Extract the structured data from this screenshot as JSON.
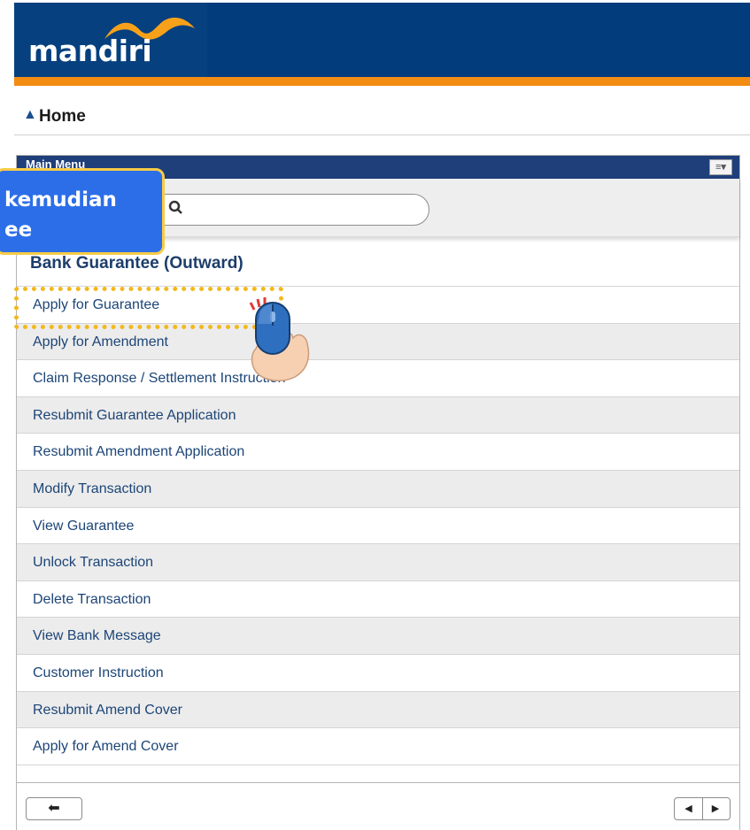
{
  "brand": {
    "name": "mandiri"
  },
  "breadcrumb": {
    "home_label": "Home"
  },
  "panel": {
    "title": "Main Menu",
    "search_placeholder": "",
    "section_title": "Bank Guarantee (Outward)",
    "items": [
      {
        "label": "Apply for Guarantee"
      },
      {
        "label": "Apply for Amendment"
      },
      {
        "label": "Claim Response / Settlement Instruction"
      },
      {
        "label": "Resubmit Guarantee Application"
      },
      {
        "label": "Resubmit Amendment Application"
      },
      {
        "label": "Modify Transaction"
      },
      {
        "label": "View Guarantee"
      },
      {
        "label": "Unlock Transaction"
      },
      {
        "label": "Delete Transaction"
      },
      {
        "label": "View Bank Message"
      },
      {
        "label": "Customer Instruction"
      },
      {
        "label": "Resubmit Amend Cover"
      },
      {
        "label": "Apply for Amend Cover"
      }
    ]
  },
  "tooltip": {
    "line1": "kemudian",
    "line2": "ee"
  },
  "icons": {
    "home": "home-icon",
    "menu": "menu-icon",
    "search": "search-icon",
    "back": "back-arrow-icon",
    "prev": "triangle-left-icon",
    "next": "triangle-right-icon",
    "hand": "hand-cursor-icon"
  },
  "colors": {
    "brand_blue": "#033c7d",
    "brand_orange": "#f28c12",
    "link": "#1c4577",
    "tooltip": "#2c6ee8",
    "highlight": "#f3b81b"
  }
}
